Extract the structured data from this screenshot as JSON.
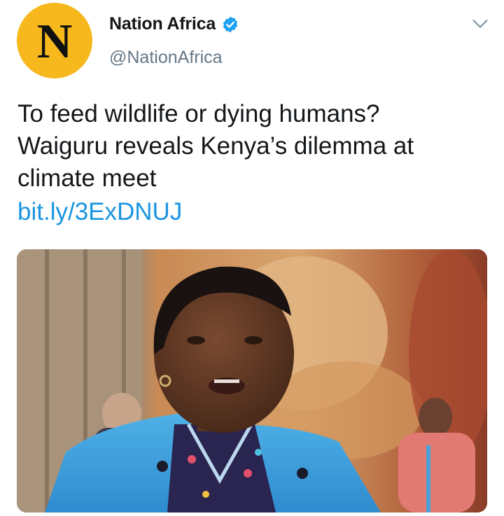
{
  "account": {
    "avatar_letter": "N",
    "display_name": "Nation Africa",
    "handle": "@NationAfrica",
    "verified": true
  },
  "tweet": {
    "text_lines": [
      "To feed wildlife or dying humans?",
      "Waiguru reveals Kenya’s dilemma at",
      "climate meet"
    ],
    "link": "bit.ly/3ExDNUJ"
  },
  "icons": {
    "verified": "verified-badge-icon",
    "menu": "chevron-down-icon"
  },
  "colors": {
    "avatar_bg": "#f6b81c",
    "verified": "#1da1f2",
    "link": "#1b95e0",
    "handle": "#657786",
    "text": "#14171a"
  }
}
